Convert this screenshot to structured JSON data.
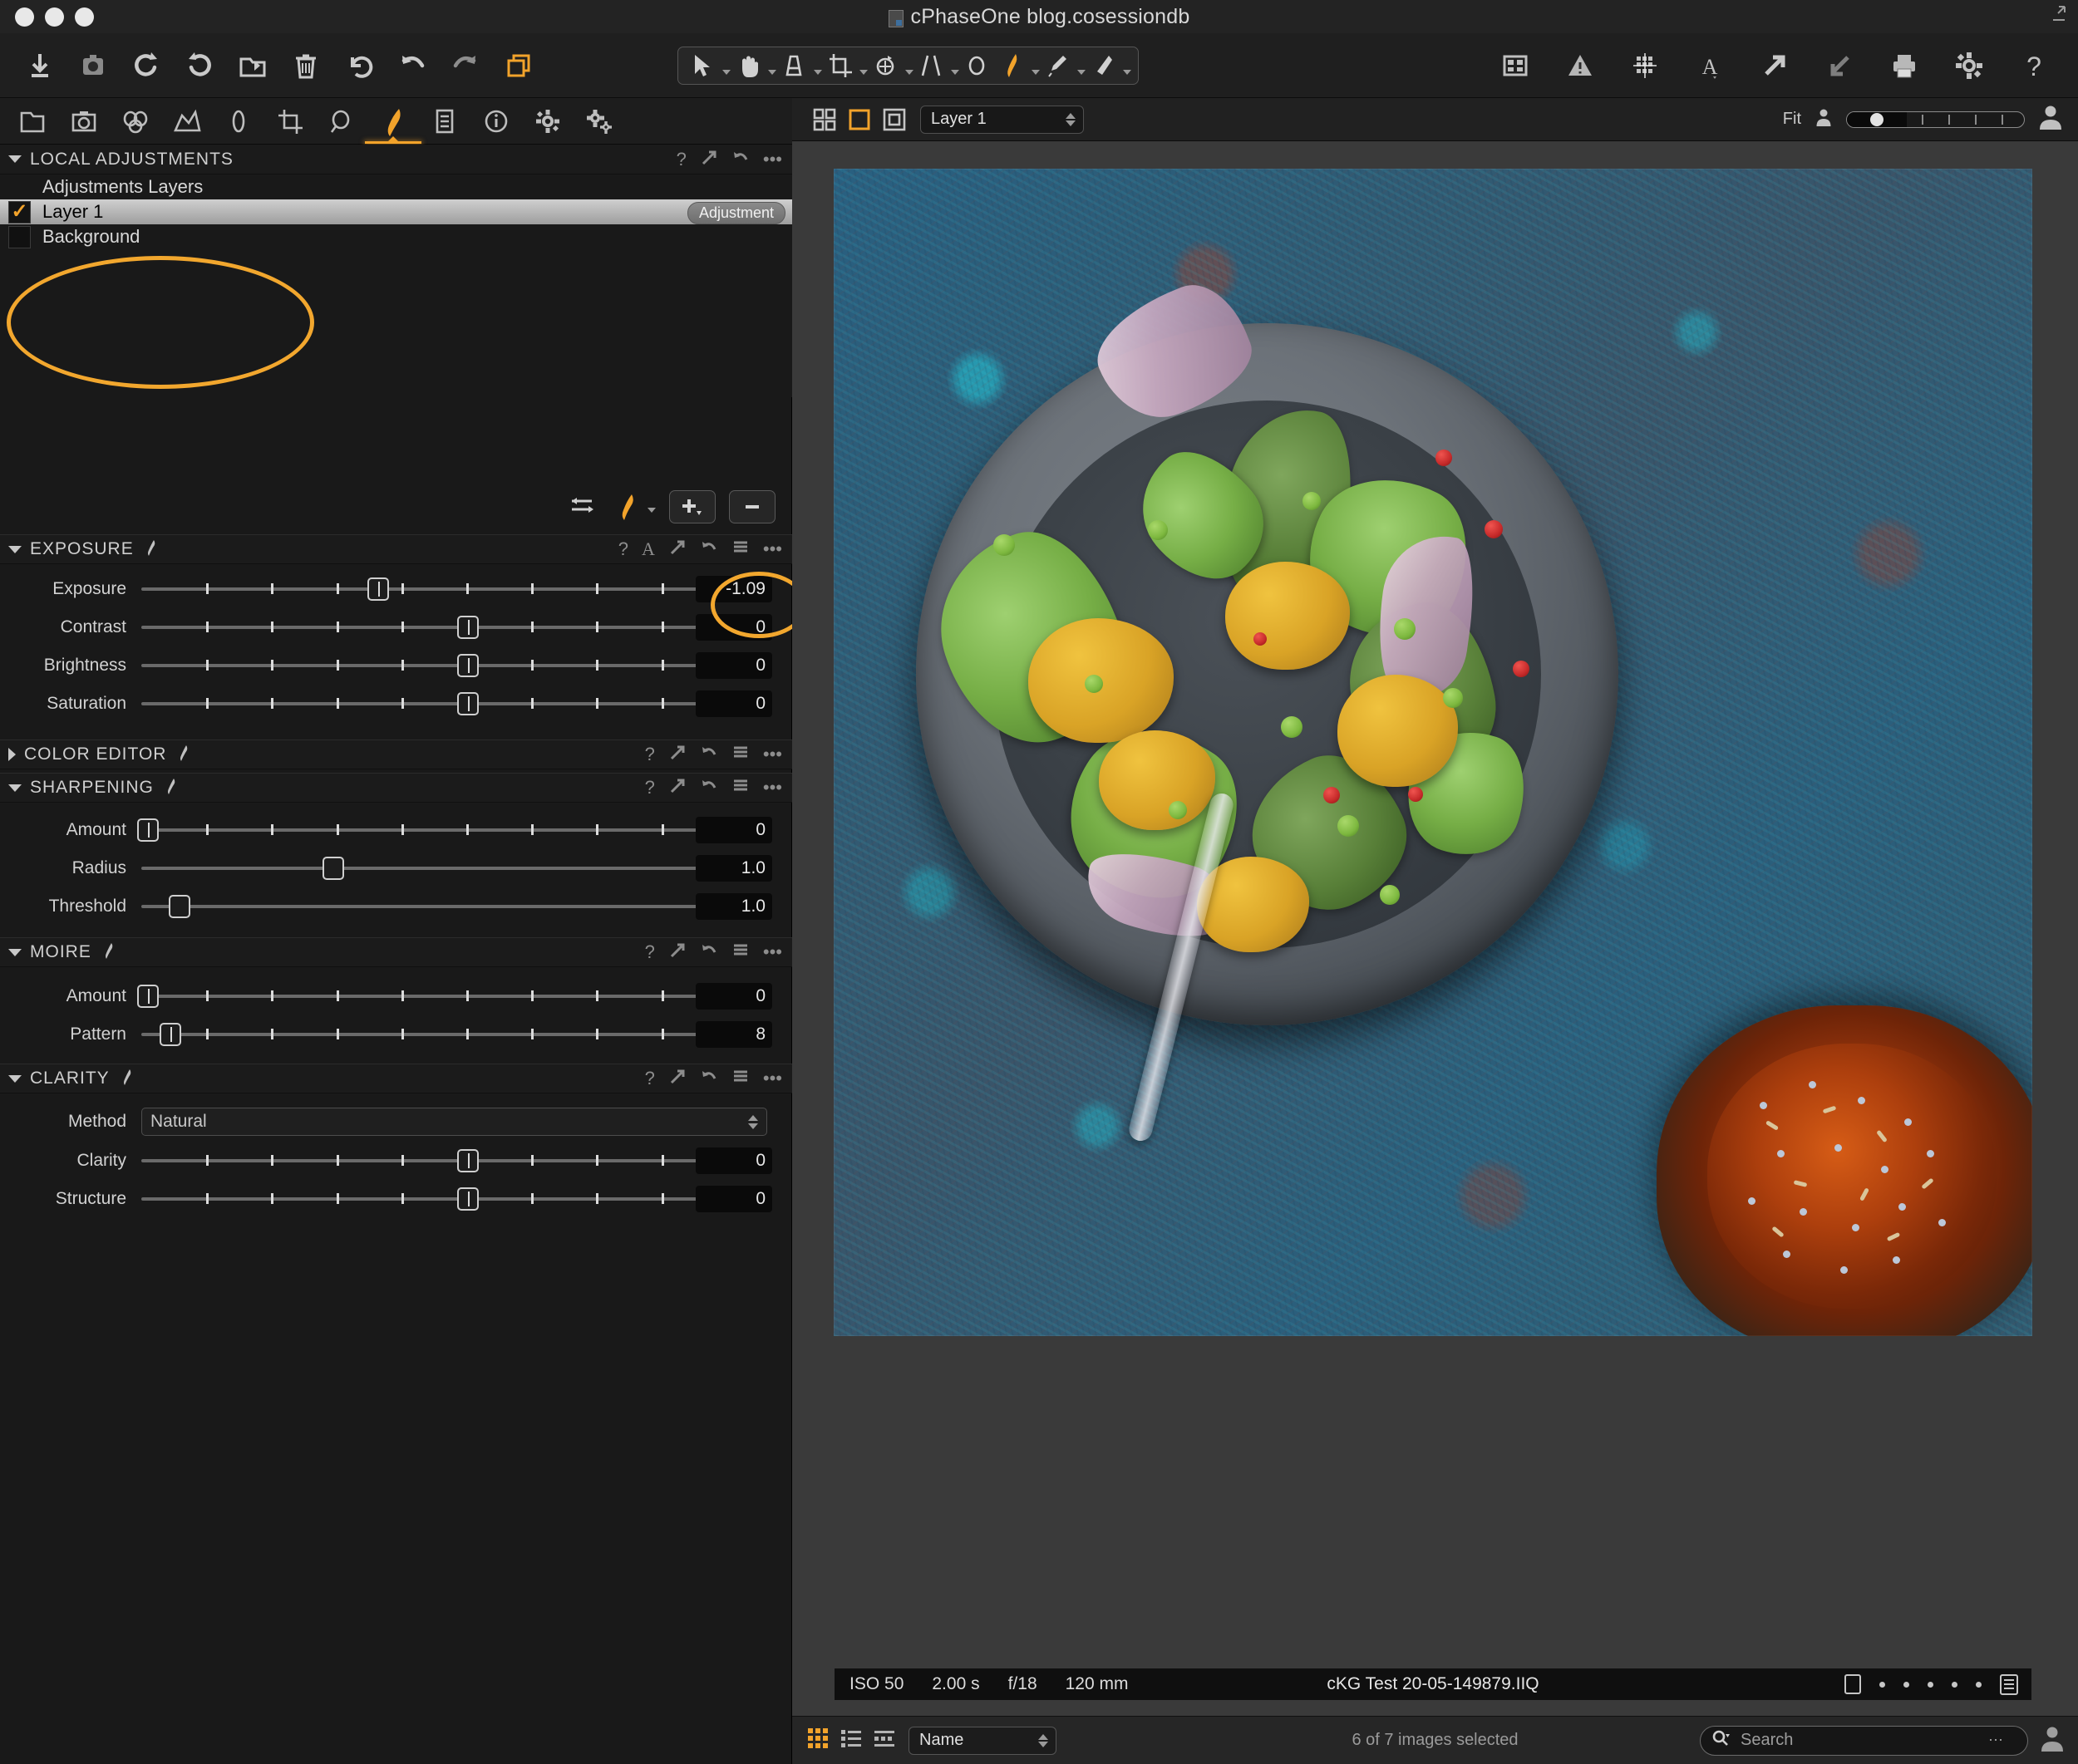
{
  "window": {
    "title": "cPhaseOne blog.cosessiondb",
    "traffic_lights": [
      "close",
      "minimize",
      "zoom"
    ]
  },
  "main_toolbar": {
    "left_tools": [
      {
        "name": "import-images",
        "icon": "download-icon"
      },
      {
        "name": "capture",
        "icon": "camera-icon"
      },
      {
        "name": "rotate-left",
        "icon": "rotate-ccw-icon"
      },
      {
        "name": "rotate-right",
        "icon": "rotate-cw-icon"
      },
      {
        "name": "move-to-folder",
        "icon": "folder-move-icon"
      },
      {
        "name": "delete",
        "icon": "trash-icon"
      },
      {
        "name": "reset",
        "icon": "reset-arrow-icon"
      },
      {
        "name": "undo",
        "icon": "undo-icon"
      },
      {
        "name": "redo",
        "icon": "redo-icon"
      },
      {
        "name": "copy-apply-adjustments",
        "icon": "copy-layers-icon"
      }
    ],
    "cursor_tools": [
      {
        "name": "select-cursor",
        "icon": "arrow-cursor-icon",
        "has_dropdown": true
      },
      {
        "name": "pan-tool",
        "icon": "hand-icon",
        "has_dropdown": true
      },
      {
        "name": "gradient-mask",
        "icon": "gradient-icon",
        "has_dropdown": true
      },
      {
        "name": "crop-tool",
        "icon": "crop-icon",
        "has_dropdown": true
      },
      {
        "name": "rotate-tool",
        "icon": "rotate-tool-icon",
        "has_dropdown": true
      },
      {
        "name": "keystone",
        "icon": "keystone-icon",
        "has_dropdown": true
      },
      {
        "name": "spot-removal",
        "icon": "spot-circle-icon",
        "has_dropdown": false
      },
      {
        "name": "draw-mask-brush",
        "icon": "brush-icon",
        "has_dropdown": true,
        "active": true
      },
      {
        "name": "color-picker",
        "icon": "eyedropper-icon",
        "has_dropdown": true
      },
      {
        "name": "eraser",
        "icon": "eraser-icon",
        "has_dropdown": true
      }
    ],
    "right_tools": [
      {
        "name": "viewer-grid",
        "icon": "grid-view-icon"
      },
      {
        "name": "alerts",
        "icon": "warning-triangle-icon"
      },
      {
        "name": "film-grid",
        "icon": "film-grid-icon"
      },
      {
        "name": "annotations",
        "icon": "letter-a-icon",
        "has_dropdown": true
      },
      {
        "name": "export-originals",
        "icon": "arrow-out-icon"
      },
      {
        "name": "import-originals",
        "icon": "arrow-in-icon"
      },
      {
        "name": "print",
        "icon": "printer-icon"
      },
      {
        "name": "preferences",
        "icon": "gear-icon"
      },
      {
        "name": "help",
        "icon": "question-mark-icon"
      }
    ]
  },
  "tool_tabs": [
    {
      "name": "library",
      "icon": "folder-icon",
      "active": false
    },
    {
      "name": "capture",
      "icon": "tethered-camera-icon",
      "active": false
    },
    {
      "name": "lens",
      "icon": "lens-circles-icon",
      "active": false
    },
    {
      "name": "color",
      "icon": "color-tent-icon",
      "active": false
    },
    {
      "name": "exposure",
      "icon": "aperture-leaf-icon",
      "active": false
    },
    {
      "name": "composition",
      "icon": "crop-frame-icon",
      "active": false
    },
    {
      "name": "details",
      "icon": "magnifier-icon",
      "active": false
    },
    {
      "name": "local-adjustments",
      "icon": "brush-icon",
      "active": true
    },
    {
      "name": "metadata",
      "icon": "document-lines-icon",
      "active": false
    },
    {
      "name": "output",
      "icon": "info-circle-icon",
      "active": false
    },
    {
      "name": "adjustments",
      "icon": "gear-icon",
      "active": false
    },
    {
      "name": "batch",
      "icon": "gears-icon",
      "active": false
    }
  ],
  "local_adjustments": {
    "title": "LOCAL ADJUSTMENTS",
    "header_icons": [
      "help-icon",
      "expand-icon",
      "reset-icon",
      "menu-dots-icon"
    ],
    "layers_header": "Adjustments Layers",
    "layers": [
      {
        "name": "Layer 1",
        "checked": true,
        "selected": true,
        "badge": "Adjustment"
      },
      {
        "name": "Background",
        "checked": false,
        "selected": false,
        "badge": ""
      }
    ],
    "controls": [
      {
        "name": "mask-invert-icon"
      },
      {
        "name": "brush-dropdown-icon"
      },
      {
        "name": "add-layer-button"
      },
      {
        "name": "remove-layer-button"
      }
    ]
  },
  "panels": {
    "exposure": {
      "title": "EXPOSURE",
      "expanded": true,
      "header_icons": [
        "help-icon",
        "auto-a-icon",
        "expand-icon",
        "reset-icon",
        "presets-icon",
        "menu-dots-icon"
      ],
      "sliders": [
        {
          "label": "Exposure",
          "value": "-1.09",
          "pos_pct": 36,
          "highlighted": true
        },
        {
          "label": "Contrast",
          "value": "0",
          "pos_pct": 50,
          "highlighted": false
        },
        {
          "label": "Brightness",
          "value": "0",
          "pos_pct": 50,
          "highlighted": false
        },
        {
          "label": "Saturation",
          "value": "0",
          "pos_pct": 50,
          "highlighted": false
        }
      ]
    },
    "color_editor": {
      "title": "COLOR EDITOR",
      "expanded": false,
      "header_icons": [
        "help-icon",
        "expand-icon",
        "reset-icon",
        "presets-icon",
        "menu-dots-icon"
      ]
    },
    "sharpening": {
      "title": "SHARPENING",
      "expanded": true,
      "header_icons": [
        "help-icon",
        "expand-icon",
        "reset-icon",
        "presets-icon",
        "menu-dots-icon"
      ],
      "sliders": [
        {
          "label": "Amount",
          "value": "0",
          "pos_pct": 0
        },
        {
          "label": "Radius",
          "value": "1.0",
          "pos_pct": 29
        },
        {
          "label": "Threshold",
          "value": "1.0",
          "pos_pct": 6
        }
      ]
    },
    "moire": {
      "title": "MOIRE",
      "expanded": true,
      "header_icons": [
        "help-icon",
        "expand-icon",
        "reset-icon",
        "presets-icon",
        "menu-dots-icon"
      ],
      "sliders": [
        {
          "label": "Amount",
          "value": "0",
          "pos_pct": 0
        },
        {
          "label": "Pattern",
          "value": "8",
          "pos_pct": 4
        }
      ]
    },
    "clarity": {
      "title": "CLARITY",
      "expanded": true,
      "header_icons": [
        "help-icon",
        "expand-icon",
        "reset-icon",
        "presets-icon",
        "menu-dots-icon"
      ],
      "method_label": "Method",
      "method_value": "Natural",
      "sliders": [
        {
          "label": "Clarity",
          "value": "0",
          "pos_pct": 50
        },
        {
          "label": "Structure",
          "value": "0",
          "pos_pct": 50
        }
      ]
    }
  },
  "viewer_toolbar": {
    "view_modes": [
      {
        "name": "multi-view-icon",
        "active": false
      },
      {
        "name": "single-view-icon",
        "active": true
      },
      {
        "name": "proof-view-icon",
        "active": false
      }
    ],
    "layer_select_value": "Layer 1",
    "fit_label": "Fit",
    "zoom_min_icon": "person-small-icon",
    "zoom_max_icon": "person-large-icon"
  },
  "image_info": {
    "iso": "ISO 50",
    "shutter": "2.00 s",
    "aperture": "f/18",
    "focal": "120 mm",
    "filename": "cKG Test 20-05-149879.IIQ",
    "right_icons": [
      "variant-square-icon",
      "rating-dot",
      "rating-dot",
      "rating-dot",
      "rating-dot",
      "rating-dot",
      "metadata-list-icon"
    ]
  },
  "bottom_bar": {
    "browse_modes": [
      {
        "name": "grid-browser-icon",
        "active": true
      },
      {
        "name": "list-browser-icon",
        "active": false
      },
      {
        "name": "filmstrip-browser-icon",
        "active": false
      }
    ],
    "sort_value": "Name",
    "status": "6 of 7 images selected",
    "search_placeholder": "Search",
    "search_value": "",
    "search_icon": "magnifier-icon",
    "user_icon": "person-icon"
  },
  "annotations": {
    "accent_color": "#f2a72e",
    "ellipses": [
      {
        "name": "layers-highlight",
        "target": "adjustment-layers-list"
      },
      {
        "name": "exposure-value-highlight",
        "target": "exposure-value"
      }
    ]
  },
  "colors": {
    "accent": "#f2a32b",
    "panel_bg": "#191919",
    "toolbar_bg": "#1f1f1f",
    "viewer_bg": "#3a3a3a",
    "text": "#d2d2d2"
  }
}
